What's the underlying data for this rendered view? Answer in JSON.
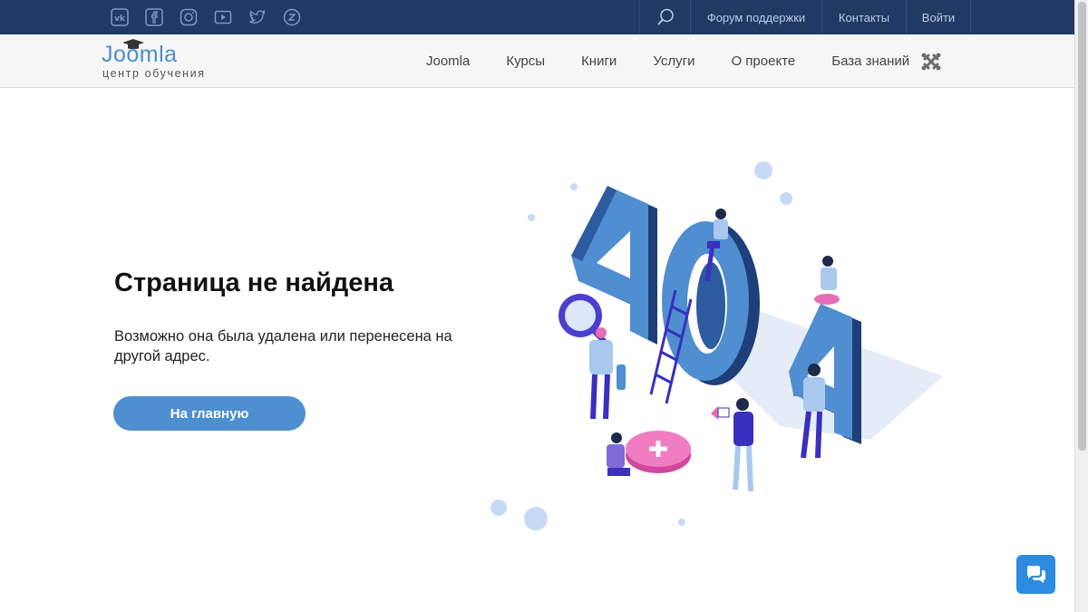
{
  "topbar": {
    "social_icons": [
      "vk-icon",
      "facebook-icon",
      "instagram-icon",
      "youtube-icon",
      "twitter-icon",
      "zen-icon"
    ],
    "links": {
      "support": "Форум поддержки",
      "contacts": "Контакты",
      "login": "Войти"
    }
  },
  "logo": {
    "word": "Joomla",
    "subtitle": "центр обучения"
  },
  "nav": {
    "items": [
      "Joomla",
      "Курсы",
      "Книги",
      "Услуги",
      "О проекте",
      "База знаний"
    ]
  },
  "content": {
    "title": "Страница не найдена",
    "description": "Возможно она была удалена или перенесена на другой адрес.",
    "home_button": "На главную"
  },
  "illustration": {
    "text": "404"
  },
  "colors": {
    "topbar": "#1f3a63",
    "accent": "#4e8fd0",
    "chat": "#2d8ce0"
  }
}
